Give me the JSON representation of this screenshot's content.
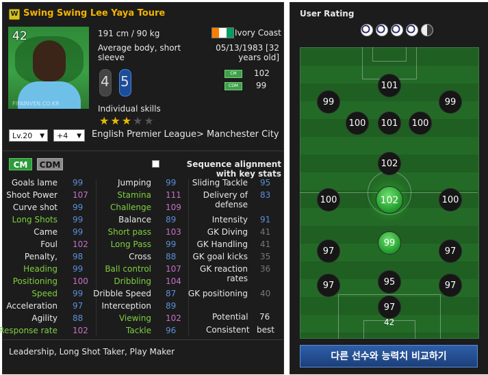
{
  "player": {
    "season_badge": "W",
    "name": "Swing Swing Lee Yaya Toure",
    "overall": "42",
    "watermark": "FIFAINVEN.CO.KR",
    "height_weight": "191 cm / 90 kg",
    "body_type": "Average body, short sleeve",
    "nation": "Ivory Coast",
    "nation_flag_colors": [
      "#f77f00",
      "#ffffff",
      "#009e60"
    ],
    "birth": "05/13/1983 [32 years old]",
    "weak_foot": "4",
    "strong_foot": "5",
    "positions": [
      {
        "tag": "CM",
        "rating": "102"
      },
      {
        "tag": "CDM",
        "rating": "99"
      }
    ],
    "skills_label": "Individual skills",
    "skill_stars": 3,
    "skill_stars_max": 5,
    "level": "Lv.20",
    "enhance": "+4",
    "league_club": "English Premier League> Manchester City"
  },
  "position_buttons": {
    "cm": "CM",
    "cdm": "CDM"
  },
  "sequence_label": "Sequence alignment with key stats",
  "stats": {
    "col1": [
      {
        "name": "Goals lame",
        "value": "99",
        "name_color": "white",
        "val_color": "blue"
      },
      {
        "name": "Shoot Power",
        "value": "107",
        "name_color": "white",
        "val_color": "pink"
      },
      {
        "name": "Curve shot",
        "value": "99",
        "name_color": "white",
        "val_color": "blue"
      },
      {
        "name": "Long Shots",
        "value": "99",
        "name_color": "green",
        "val_color": "blue"
      },
      {
        "name": "Came",
        "value": "99",
        "name_color": "white",
        "val_color": "blue"
      },
      {
        "name": "Foul",
        "value": "102",
        "name_color": "white",
        "val_color": "pink"
      },
      {
        "name": "Penalty,",
        "value": "98",
        "name_color": "white",
        "val_color": "blue"
      },
      {
        "name": "Heading",
        "value": "99",
        "name_color": "green",
        "val_color": "blue"
      },
      {
        "name": "Positioning",
        "value": "100",
        "name_color": "green",
        "val_color": "pink"
      },
      {
        "name": "Speed",
        "value": "99",
        "name_color": "green",
        "val_color": "blue"
      },
      {
        "name": "Acceleration",
        "value": "97",
        "name_color": "white",
        "val_color": "blue"
      },
      {
        "name": "Agility",
        "value": "88",
        "name_color": "white",
        "val_color": "blue"
      },
      {
        "name": "Response rate",
        "value": "102",
        "name_color": "green",
        "val_color": "pink"
      }
    ],
    "col2": [
      {
        "name": "Jumping",
        "value": "99",
        "name_color": "white",
        "val_color": "blue"
      },
      {
        "name": "Stamina",
        "value": "111",
        "name_color": "green",
        "val_color": "pink"
      },
      {
        "name": "Challenge",
        "value": "109",
        "name_color": "green",
        "val_color": "pink"
      },
      {
        "name": "Balance",
        "value": "89",
        "name_color": "white",
        "val_color": "blue"
      },
      {
        "name": "Short pass",
        "value": "103",
        "name_color": "green",
        "val_color": "pink"
      },
      {
        "name": "Long Pass",
        "value": "99",
        "name_color": "green",
        "val_color": "blue"
      },
      {
        "name": "Cross",
        "value": "88",
        "name_color": "white",
        "val_color": "blue"
      },
      {
        "name": "Ball control",
        "value": "107",
        "name_color": "green",
        "val_color": "pink"
      },
      {
        "name": "Dribbling",
        "value": "104",
        "name_color": "green",
        "val_color": "pink"
      },
      {
        "name": "Dribble Speed",
        "value": "87",
        "name_color": "white",
        "val_color": "blue"
      },
      {
        "name": "Interception",
        "value": "89",
        "name_color": "white",
        "val_color": "blue"
      },
      {
        "name": "Viewing",
        "value": "102",
        "name_color": "green",
        "val_color": "pink"
      },
      {
        "name": "Tackle",
        "value": "96",
        "name_color": "green",
        "val_color": "blue"
      }
    ],
    "col3": [
      {
        "name": "Sliding Tackle",
        "value": "95",
        "name_color": "white",
        "val_color": "blue",
        "lines": 1
      },
      {
        "name": "Delivery of defense",
        "value": "83",
        "name_color": "white",
        "val_color": "blue",
        "lines": 2
      },
      {
        "name": "Intensity",
        "value": "91",
        "name_color": "white",
        "val_color": "blue",
        "lines": 1
      },
      {
        "name": "GK Diving",
        "value": "41",
        "name_color": "white",
        "val_color": "gray",
        "lines": 1
      },
      {
        "name": "GK Handling",
        "value": "41",
        "name_color": "white",
        "val_color": "gray",
        "lines": 1
      },
      {
        "name": "GK goal kicks",
        "value": "35",
        "name_color": "white",
        "val_color": "gray",
        "lines": 1
      },
      {
        "name": "GK reaction rates",
        "value": "36",
        "name_color": "white",
        "val_color": "gray",
        "lines": 2
      },
      {
        "name": "GK positioning",
        "value": "40",
        "name_color": "white",
        "val_color": "gray",
        "lines": 1
      }
    ],
    "potential_label": "Potential",
    "potential_value": "76",
    "consistent_label": "Consistent",
    "consistent_value": "best"
  },
  "traits": "Leadership, Long Shot Taker, Play Maker",
  "user_rating": {
    "title": "User Rating",
    "balls": 4.5,
    "pitch": {
      "st": "101",
      "lw": "99",
      "rw": "99",
      "lcf": "100",
      "cf": "101",
      "rcf": "100",
      "cam": "102",
      "lm": "100",
      "cm": "102",
      "rm": "100",
      "cdm": "99",
      "lwb": "97",
      "rwb": "97",
      "lb": "97",
      "cb": "95",
      "rb": "97",
      "gk": "97",
      "gk_overall": "42"
    }
  },
  "compare_button": "다른 선수와 능력치 비교하기"
}
